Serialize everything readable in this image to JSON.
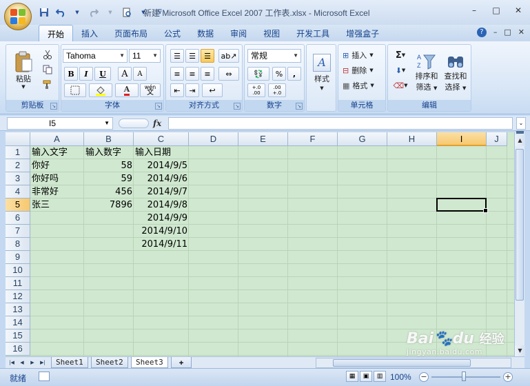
{
  "window": {
    "title": "新建 Microsoft Office Excel 2007 工作表.xlsx - Microsoft Excel",
    "controls": [
      "–",
      "□",
      "✕"
    ]
  },
  "quick_access": {
    "save_icon": "save-icon",
    "undo_icon": "undo-icon",
    "redo_icon": "redo-icon",
    "print_preview_icon": "print-preview-icon",
    "customize_icon": "customize-icon"
  },
  "tabs": [
    "开始",
    "插入",
    "页面布局",
    "公式",
    "数据",
    "审阅",
    "视图",
    "开发工具",
    "增强盒子"
  ],
  "active_tab": "开始",
  "ribbon": {
    "clipboard": {
      "label": "剪贴板",
      "paste_label": "粘贴"
    },
    "font": {
      "label": "字体",
      "font_name": "Tahoma",
      "font_size": "11",
      "bold": "B",
      "italic": "I",
      "underline": "U",
      "grow": "A",
      "shrink": "A",
      "wen": "wén",
      "wen_char": "文"
    },
    "alignment": {
      "label": "对齐方式"
    },
    "number": {
      "label": "数字",
      "format": "常规",
      "percent": "%",
      "comma": ",",
      "inc_decimal": "+.0 .00",
      "dec_decimal": ".00 +.0"
    },
    "styles": {
      "label": "样式"
    },
    "cells": {
      "label": "单元格",
      "insert": "插入",
      "delete": "删除",
      "format": "格式"
    },
    "editing": {
      "label": "编辑",
      "sum": "Σ",
      "sort_filter": [
        "排序和",
        "筛选"
      ],
      "find_select": [
        "查找和",
        "选择"
      ]
    }
  },
  "formula_bar": {
    "name_box": "I5",
    "fx": "fx",
    "formula": ""
  },
  "sheet": {
    "columns": [
      "A",
      "B",
      "C",
      "D",
      "E",
      "F",
      "G",
      "H",
      "I",
      "J"
    ],
    "selected_column": "I",
    "rows": [
      "1",
      "2",
      "3",
      "4",
      "5",
      "6",
      "7",
      "8",
      "9",
      "10",
      "11",
      "12",
      "13",
      "14",
      "15",
      "16"
    ],
    "selected_row": "5",
    "cells": {
      "A1": "输入文字",
      "B1": "输入数字",
      "C1": "输入日期",
      "A2": "你好",
      "B2": "58",
      "C2": "2014/9/5",
      "A3": "你好吗",
      "B3": "59",
      "C3": "2014/9/6",
      "A4": "非常好",
      "B4": "456",
      "C4": "2014/9/7",
      "A5": "张三",
      "B5": "7896",
      "C5": "2014/9/8",
      "C6": "2014/9/9",
      "C7": "2014/9/10",
      "C8": "2014/9/11"
    }
  },
  "sheet_tabs": [
    "Sheet1",
    "Sheet2",
    "Sheet3"
  ],
  "active_sheet": "Sheet3",
  "status": {
    "ready": "就绪",
    "zoom": "100%",
    "zoom_minus": "−",
    "zoom_plus": "+"
  },
  "watermark": {
    "line1": "Bai",
    "mid": "du",
    "tail": "经验",
    "line2": "jingyan.baidu.com"
  },
  "colors": {
    "accent": "#15428b",
    "grid_bg": "#cfe8cf",
    "selection_header": "#f7c86e"
  }
}
